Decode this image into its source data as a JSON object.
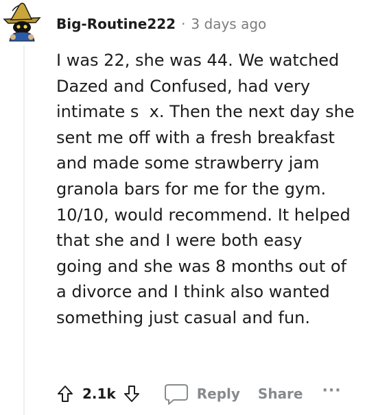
{
  "comment": {
    "username": "Big-Routine222",
    "separator": "·",
    "timestamp": "3 days ago",
    "lines": [
      "I was 22, she was 44. We watched",
      "Dazed and Confused, had very",
      "intimate s  x. Then the next day she",
      "sent me off with a fresh breakfast",
      "and made some strawberry jam",
      "granola bars for me for the gym.",
      "10/10, would recommend. It helped",
      "that she and I were both easy",
      "going and she was 8 months out of",
      "a divorce and I think also wanted",
      "something just casual and fun."
    ]
  },
  "actions": {
    "score": "2.1k",
    "reply_label": "Reply",
    "share_label": "Share",
    "more_label": "···"
  },
  "icons": {
    "avatar": "black-mage-avatar-icon",
    "upvote": "upvote-arrow-icon",
    "downvote": "downvote-arrow-icon",
    "reply": "speech-bubble-icon"
  },
  "colors": {
    "text": "#1c1c1c",
    "meta": "#7c7c7c",
    "action": "#878a8c",
    "thread_line": "#edeff1",
    "avatar_hat": "#b8962e"
  }
}
